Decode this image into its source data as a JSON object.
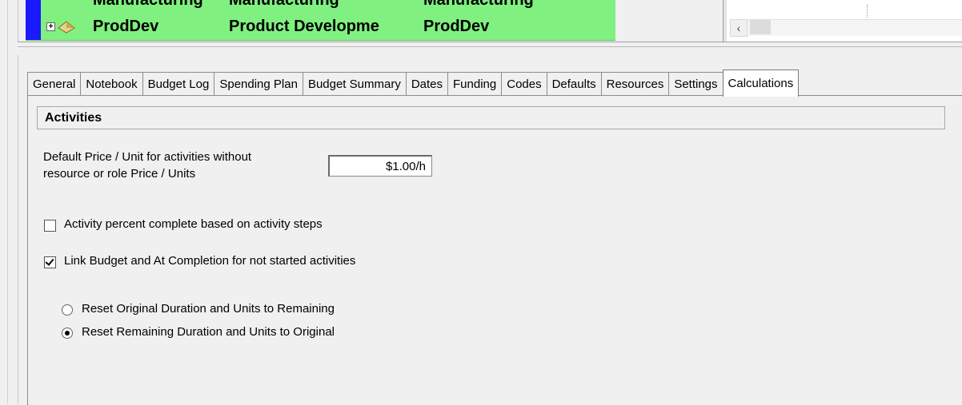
{
  "grid": {
    "rows": [
      {
        "id": "Manufacturing",
        "name": "Manufacturing",
        "code": "Manufacturing"
      },
      {
        "id": "ProdDev",
        "name": "Product Developme",
        "code": "ProdDev"
      }
    ],
    "expand_symbol": "+"
  },
  "scroll": {
    "left_arrow": "‹"
  },
  "tabs": [
    {
      "label": "General"
    },
    {
      "label": "Notebook"
    },
    {
      "label": "Budget Log"
    },
    {
      "label": "Spending Plan"
    },
    {
      "label": "Budget Summary"
    },
    {
      "label": "Dates"
    },
    {
      "label": "Funding"
    },
    {
      "label": "Codes"
    },
    {
      "label": "Defaults"
    },
    {
      "label": "Resources"
    },
    {
      "label": "Settings"
    },
    {
      "label": "Calculations",
      "active": true
    }
  ],
  "calculations": {
    "section_title": "Activities",
    "default_price_label_line1": "Default Price / Unit for activities without",
    "default_price_label_line2": "resource or role Price / Units",
    "default_price_value": "$1.00/h",
    "percent_complete_label": "Activity percent complete based on activity steps",
    "percent_complete_checked": false,
    "link_budget_label": "Link Budget and At Completion for not started activities",
    "link_budget_checked": true,
    "radio_reset_original_label": "Reset Original Duration and Units to Remaining",
    "radio_reset_remaining_label": "Reset Remaining Duration and Units to Original",
    "selected_option": "Reset Remaining Duration and Units to Original"
  },
  "colors": {
    "wbs_row_bg": "#80f080",
    "selection_bar": "#1a1aff"
  }
}
